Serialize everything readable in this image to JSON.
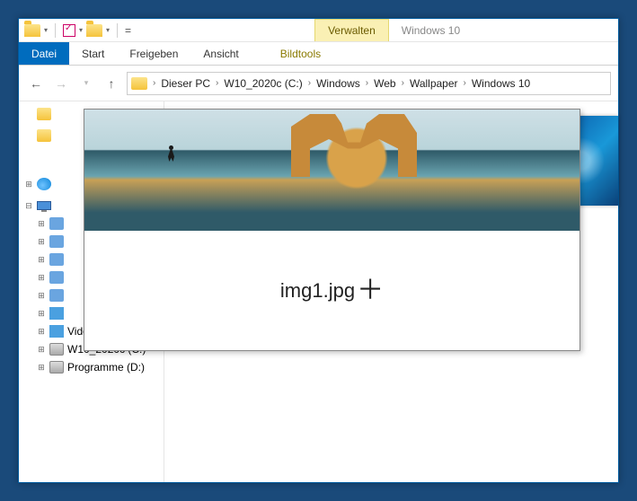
{
  "qat": {
    "contextual_tab": "Verwalten",
    "title": "Windows 10"
  },
  "ribbon": {
    "file": "Datei",
    "tabs": [
      "Start",
      "Freigeben",
      "Ansicht"
    ],
    "tools": "Bildtools"
  },
  "breadcrumb": {
    "items": [
      "Dieser PC",
      "W10_2020c (C:)",
      "Windows",
      "Web",
      "Wallpaper",
      "Windows 10"
    ]
  },
  "tree": {
    "items": [
      {
        "label": "Videos",
        "icon": "video"
      },
      {
        "label": "W10_2020c (C:)",
        "icon": "drive"
      },
      {
        "label": "Programme (D:)",
        "icon": "drive"
      }
    ]
  },
  "preview": {
    "filename": "img1.jpg"
  }
}
